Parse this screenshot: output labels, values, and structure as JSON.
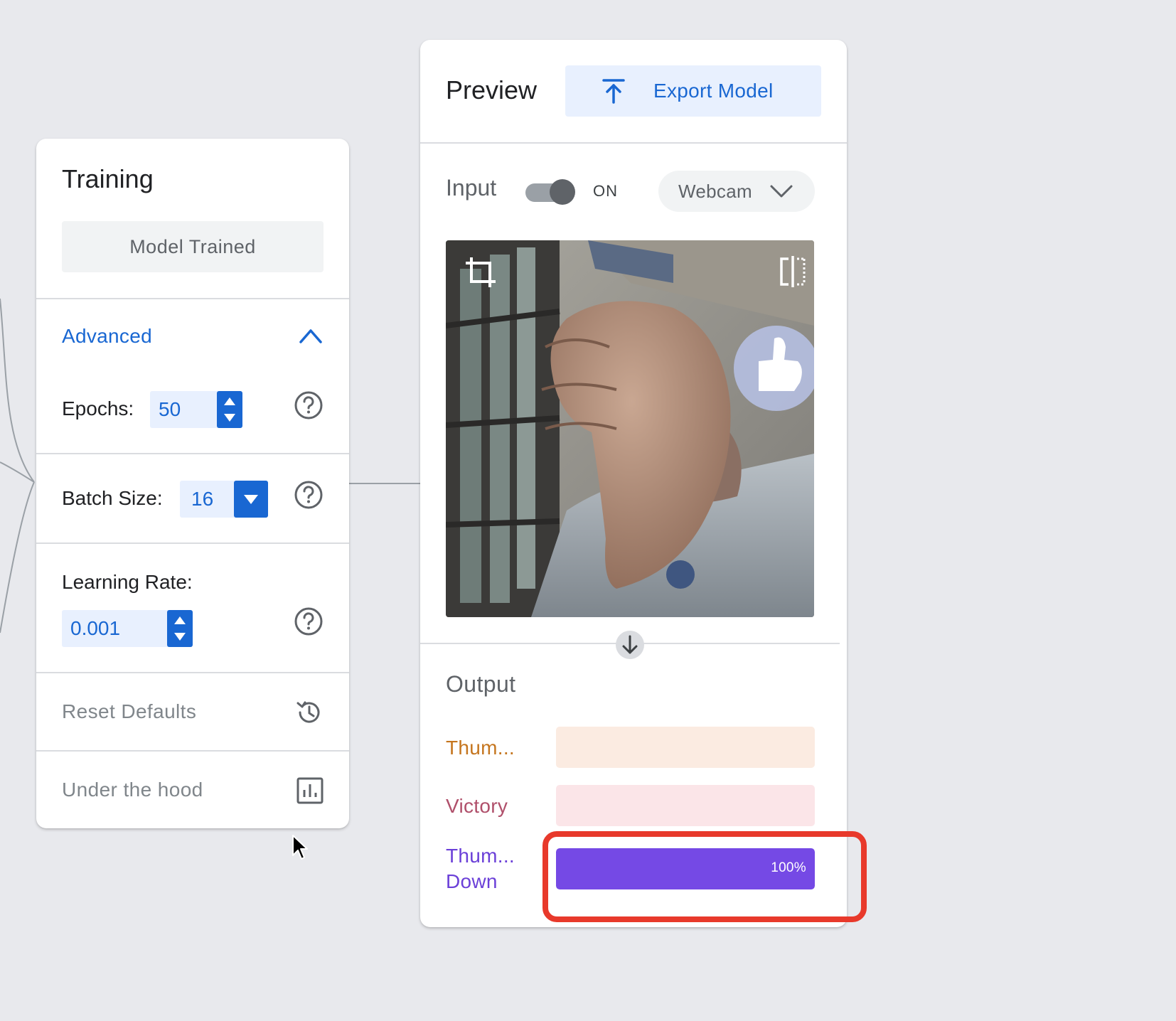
{
  "training": {
    "title": "Training",
    "status_button": "Model Trained",
    "advanced_label": "Advanced",
    "epochs_label": "Epochs:",
    "epochs_value": "50",
    "batch_size_label": "Batch Size:",
    "batch_size_value": "16",
    "learning_rate_label": "Learning Rate:",
    "learning_rate_value": "0.001",
    "reset_defaults_label": "Reset Defaults",
    "under_the_hood_label": "Under the hood"
  },
  "preview": {
    "title": "Preview",
    "export_label": "Export Model",
    "input_label": "Input",
    "toggle_state": "ON",
    "source_selected": "Webcam",
    "output_label": "Output",
    "classes": [
      {
        "line1": "Thum...",
        "line2": "",
        "color": "#c5761f",
        "track_color": "#fbebe1",
        "percent": 0,
        "percent_label": ""
      },
      {
        "line1": "Victory",
        "line2": "",
        "color": "#b0506b",
        "track_color": "#fbe5e8",
        "percent": 0,
        "percent_label": ""
      },
      {
        "line1": "Thum...",
        "line2": "Down",
        "color": "#6b40d8",
        "track_color": "#ece6fb",
        "percent": 100,
        "percent_label": "100%",
        "fill_color": "#7549e5"
      }
    ]
  },
  "colors": {
    "accent_blue": "#1967d2",
    "highlight_red": "#e8392b"
  },
  "icons": [
    "chevron-up-icon",
    "help-icon",
    "history-icon",
    "bar-chart-icon",
    "upload-icon",
    "chevron-down-icon",
    "crop-icon",
    "flip-icon",
    "arrow-down-icon",
    "mouse-cursor-icon"
  ]
}
